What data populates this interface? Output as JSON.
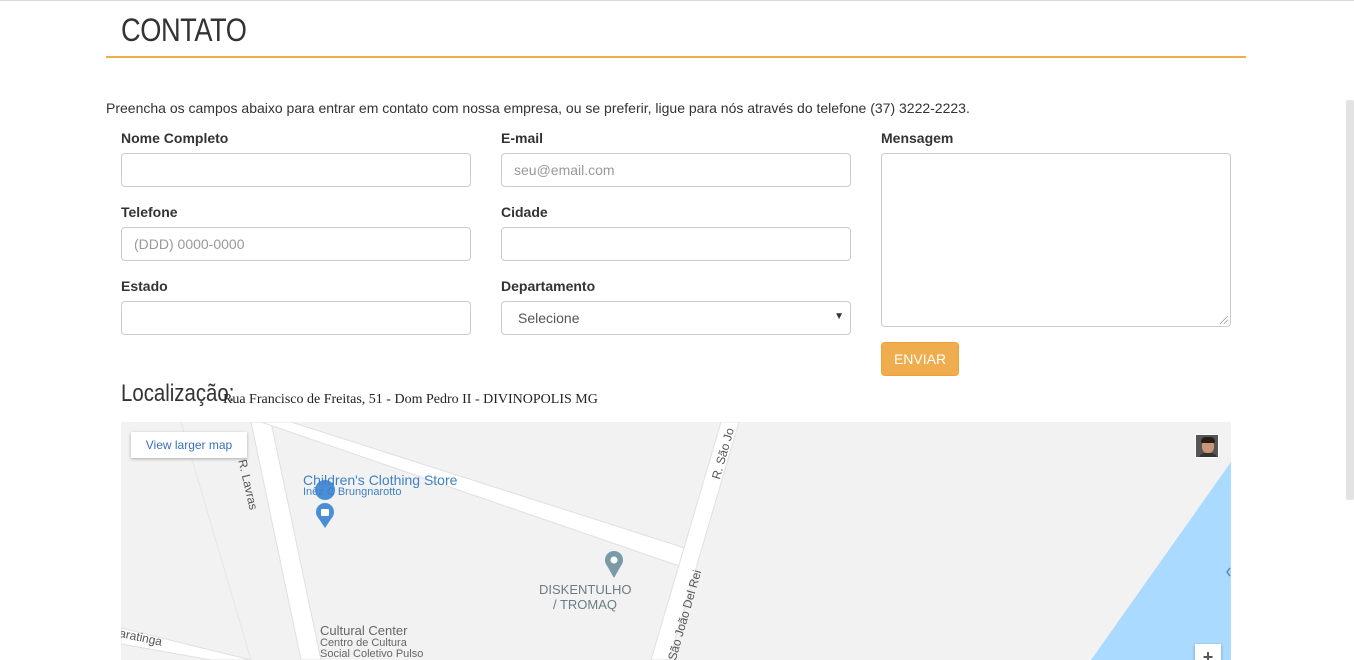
{
  "page": {
    "title": "CONTATO",
    "intro": "Preencha os campos abaixo para entrar em contato com nossa empresa, ou se preferir, ligue para nós através do telefone (37) 3222-2223."
  },
  "form": {
    "nome_label": "Nome Completo",
    "email_label": "E-mail",
    "email_placeholder": "seu@email.com",
    "mensagem_label": "Mensagem",
    "telefone_label": "Telefone",
    "telefone_placeholder": "(DDD) 0000-0000",
    "cidade_label": "Cidade",
    "estado_label": "Estado",
    "departamento_label": "Departamento",
    "departamento_value": "Selecione",
    "send_label": "ENVIAR"
  },
  "location": {
    "label": "Localização:",
    "address": "Rua Francisco de Freitas, 51 - Dom Pedro II - DIVINOPOLIS MG"
  },
  "map": {
    "view_larger": "View larger map",
    "street_lavras": "R. Lavras",
    "street_sao_joao_top": "R. São Jo",
    "street_sao_joao_bottom": "São João Del Rei",
    "street_aratinga": "aratinga",
    "poi_clothing_name": "Children's Clothing Store",
    "poi_clothing_sub": "Inêz C Brungnarotto",
    "poi_disk_line1": "DISKENTULHO",
    "poi_disk_line2": "/ TROMAQ",
    "poi_cultural_name": "Cultural Center",
    "poi_cultural_sub1": "Centro de Cultura",
    "poi_cultural_sub2": "Social Coletivo Pulso",
    "zoom_in": "+",
    "water_color": "#aadaff",
    "road_color": "#ffffff",
    "poi_blue": "#4a8fd6",
    "poi_gray": "#7b9aa8"
  },
  "colors": {
    "accent": "#f0ad4e",
    "title_rule": "#f0ad4e"
  }
}
